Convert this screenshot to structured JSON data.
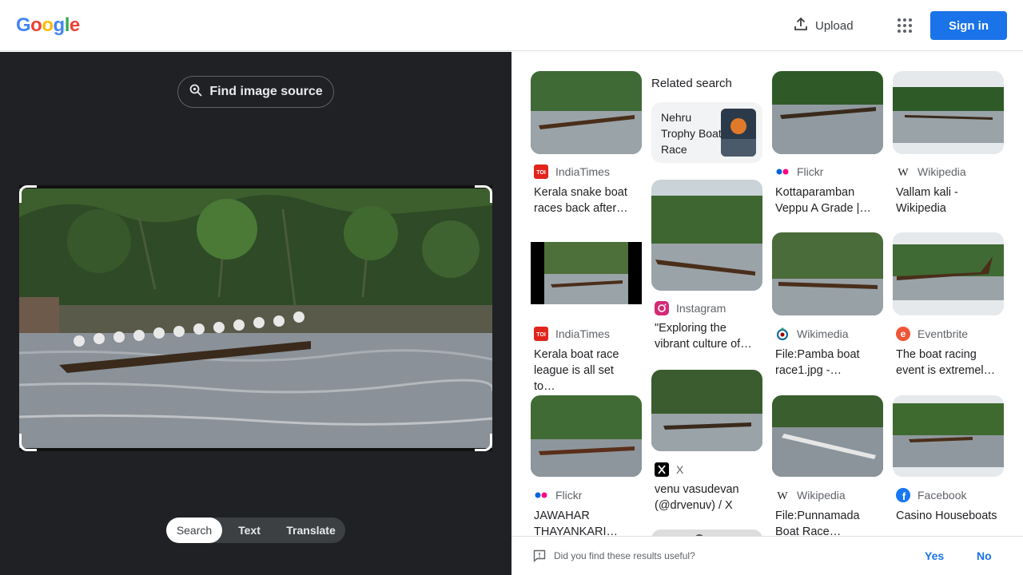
{
  "header": {
    "logo_letters": [
      "G",
      "o",
      "o",
      "g",
      "l",
      "e"
    ],
    "logo_colors": [
      "#4285f4",
      "#ea4335",
      "#fbbc05",
      "#4285f4",
      "#34a853",
      "#ea4335"
    ],
    "upload_label": "Upload",
    "signin_label": "Sign in"
  },
  "lens": {
    "find_source_label": "Find image source",
    "modes": [
      "Search",
      "Text",
      "Translate"
    ],
    "active_mode": "Search"
  },
  "results": {
    "related_title": "Related search",
    "related_query": "Nehru Trophy Boat Race",
    "items": [
      {
        "source": "IndiaTimes",
        "caption": "Kerala snake boat races back after…",
        "icon": "toi-icon"
      },
      {
        "source": "Flickr",
        "caption": "Kottaparamban Veppu A Grade |…",
        "icon": "flickr-icon"
      },
      {
        "source": "Wikipedia",
        "caption": "Vallam kali - Wikipedia",
        "icon": "wikipedia-icon"
      },
      {
        "source": "IndiaTimes",
        "caption": "Kerala boat race league is all set to…",
        "icon": "toi-icon"
      },
      {
        "source": "Instagram",
        "caption": "\"Exploring the vibrant culture of…",
        "icon": "instagram-icon"
      },
      {
        "source": "Wikimedia",
        "caption": "File:Pamba boat race1.jpg -…",
        "icon": "wikimedia-icon"
      },
      {
        "source": "Eventbrite",
        "caption": "The boat racing event is extremel…",
        "icon": "eventbrite-icon"
      },
      {
        "source": "Flickr",
        "caption": "JAWAHAR THAYANKARI…",
        "icon": "flickr-icon"
      },
      {
        "source": "X",
        "caption": "venu vasudevan (@drvenuv) / X",
        "icon": "x-icon"
      },
      {
        "source": "Wikipedia",
        "caption": "File:Punnamada Boat Race…",
        "icon": "wikipedia-icon"
      },
      {
        "source": "Facebook",
        "caption": "Casino Houseboats",
        "icon": "facebook-icon"
      }
    ]
  },
  "feedback": {
    "question": "Did you find these results useful?",
    "yes": "Yes",
    "no": "No"
  },
  "colors": {
    "accent": "#1a73e8",
    "panel_dark": "#202124",
    "water": "#8a9198",
    "foliage": "#2f4a25",
    "boat": "#3a2a1c"
  }
}
